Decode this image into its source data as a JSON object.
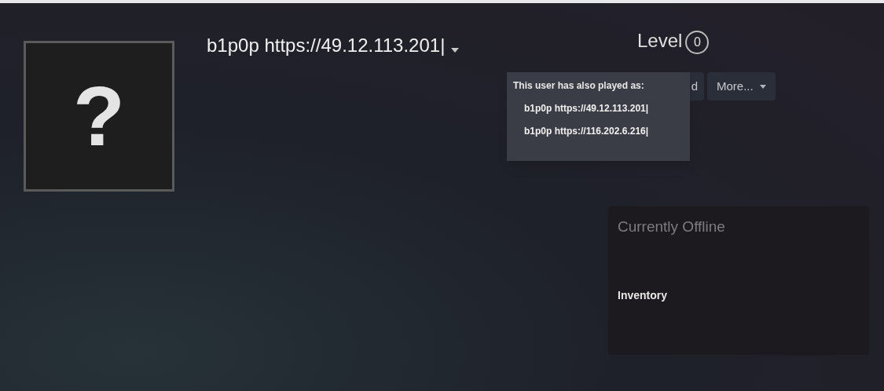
{
  "profile": {
    "name": "b1p0p https://49.12.113.201|",
    "avatar": "?",
    "level_label": "Level",
    "level": "0"
  },
  "buttons": [
    {
      "label": "d",
      "kind": "hidden"
    },
    {
      "label": "More...",
      "kind": "menu"
    }
  ],
  "alias_popup": {
    "title": "This user has also played as:",
    "aliases": [
      "b1p0p https://49.12.113.201|",
      "b1p0p https://116.202.6.216|"
    ]
  },
  "status_card": {
    "status": "Currently Offline",
    "link": "Inventory"
  }
}
